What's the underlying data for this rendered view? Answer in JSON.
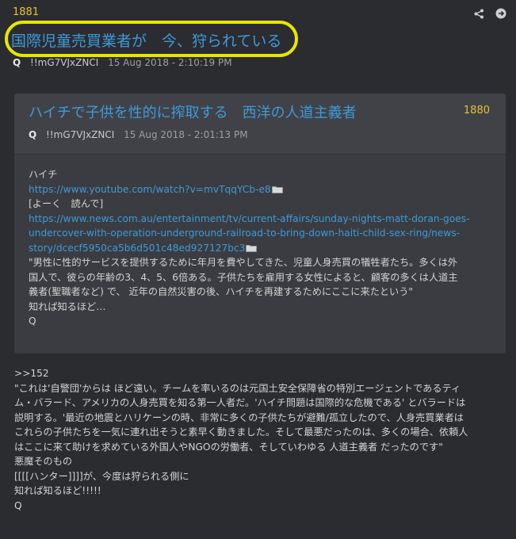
{
  "post": {
    "number": "1881",
    "title": "国際児童売買業者が　今、狩られている",
    "author": "Q",
    "tripcode": "!!mG7VJxZNCI",
    "timestamp": "15 Aug 2018 - 2:10:19 PM",
    "actions": [
      "share-icon",
      "goto-icon"
    ]
  },
  "quoted": {
    "number": "1880",
    "title": "ハイチで子供を性的に搾取する　西洋の人道主義者",
    "author": "Q",
    "tripcode": "!!mG7VJxZNCI",
    "timestamp": "15 Aug 2018 - 2:01:13 PM",
    "lines": {
      "l1": "ハイチ",
      "link1": "https://www.youtube.com/watch?v=mvTqqYCb-e8",
      "l3": "[よーく　読んで]",
      "link2a": "https://www.news.com.au/entertainment/tv/current-affairs/sunday-nights-matt-doran-goes-",
      "link2b": "undercover-with-operation-underground-railroad-to-bring-down-haiti-child-sex-ring/news-",
      "link2c": "story/dcecf5950ca5b6d501c48ed927127bc3",
      "l7": "\"男性に性的サービスを提供するために年月を費やしてきた、児童人身売買の犠牲者たち。多くは外",
      "l8": "国人で、彼らの年齢の3、4、5、6倍ある。子供たちを雇用する女性によると、顧客の多くは人道主",
      "l9": "義者(聖職者など) で、 近年の自然災害の後、ハイチを再建するためにここに来たという\"",
      "l10": "知れば知るほど…",
      "l11": "Q"
    }
  },
  "reply": {
    "l1": ">>152",
    "l2": "\"これは'自警団'からは ほど遠い。チームを率いるのは元国土安全保障省の特別エージェントであるティ",
    "l3": "ム・バラード、アメリカの人身売買を知る第一人者だ。'ハイチ問題は国際的な危機である' とバラードは",
    "l4": "説明する。'最近の地震とハリケーンの時、非常に多くの子供たちが避難/孤立したので、人身売買業者は",
    "l5": "これらの子供たちを一気に連れ出そうと素早く動きました。そして最悪だったのは、多くの場合、依頼人",
    "l6": "はここに来て助けを求めている外国人やNGOの労働者、そしていわゆる 人道主義者 だったのです\"",
    "l7": "悪魔そのもの",
    "l8": "[[[[ハンター]]]]が、今度は狩られる側に",
    "l9": "知れば知るほど!!!!!",
    "l10": "Q"
  }
}
